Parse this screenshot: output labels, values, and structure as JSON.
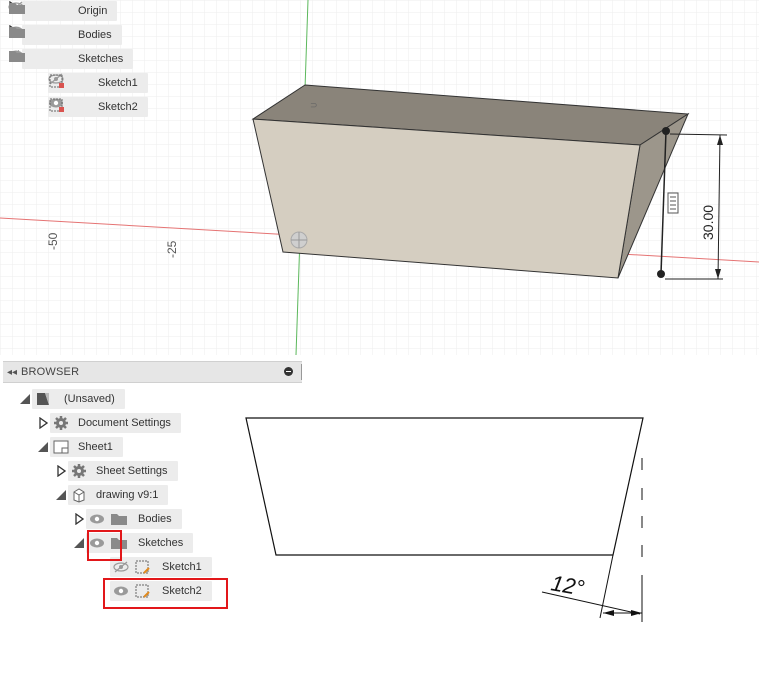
{
  "viewport_tree": [
    {
      "label": "Origin",
      "expanded": false,
      "visible": false,
      "icon": "folder-icon"
    },
    {
      "label": "Bodies",
      "expanded": false,
      "visible": true,
      "icon": "folder-icon"
    },
    {
      "label": "Sketches",
      "expanded": true,
      "visible": true,
      "icon": "folder-icon"
    },
    {
      "label": "Sketch1",
      "visible": false,
      "icon": "sketch-icon"
    },
    {
      "label": "Sketch2",
      "visible": true,
      "icon": "sketch-icon"
    }
  ],
  "viewport_axis_labels": [
    "-50",
    "-25"
  ],
  "dimension_value": "30.00",
  "browser": {
    "title": "BROWSER",
    "items": [
      {
        "label": "(Unsaved)",
        "expanded": true,
        "icon": "drawing-doc-icon"
      },
      {
        "label": "Document Settings",
        "expanded": false,
        "icon": "gear-icon"
      },
      {
        "label": "Sheet1",
        "expanded": true,
        "icon": "sheet-icon"
      },
      {
        "label": "Sheet Settings",
        "expanded": false,
        "icon": "gear-icon"
      },
      {
        "label": "drawing v9:1",
        "expanded": true,
        "icon": "component-icon"
      },
      {
        "label": "Bodies",
        "expanded": false,
        "visible": true,
        "icon": "folder-icon"
      },
      {
        "label": "Sketches",
        "expanded": true,
        "visible": true,
        "icon": "folder-icon"
      },
      {
        "label": "Sketch1",
        "visible": false,
        "icon": "sketch-icon"
      },
      {
        "label": "Sketch2",
        "visible": true,
        "icon": "sketch-icon"
      }
    ]
  },
  "drawing_angle": "12°",
  "colors": {
    "highlight": "#e2171a",
    "x_axis": "#e57373",
    "y_axis": "#4caf50",
    "body_front": "#d6cfc2",
    "body_top": "#8d877c",
    "body_side": "#9d978c"
  }
}
